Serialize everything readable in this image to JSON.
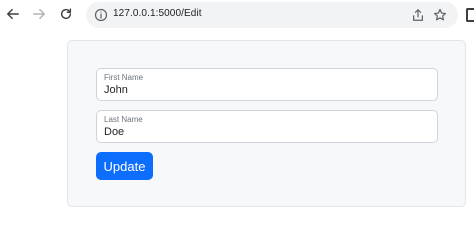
{
  "browser": {
    "url": "127.0.0.1:5000/Edit",
    "icons": {
      "back": "arrow-left-icon",
      "forward": "arrow-right-icon",
      "reload": "reload-icon",
      "site_info": "info-icon",
      "share": "share-icon",
      "bookmark": "star-icon",
      "side_panel": "side-panel-icon"
    }
  },
  "form": {
    "first_name": {
      "label": "First Name",
      "value": "John"
    },
    "last_name": {
      "label": "Last Name",
      "value": "Doe"
    },
    "submit_label": "Update"
  },
  "colors": {
    "primary_button": "#0d6efd",
    "card_background": "#f7f8fa"
  }
}
